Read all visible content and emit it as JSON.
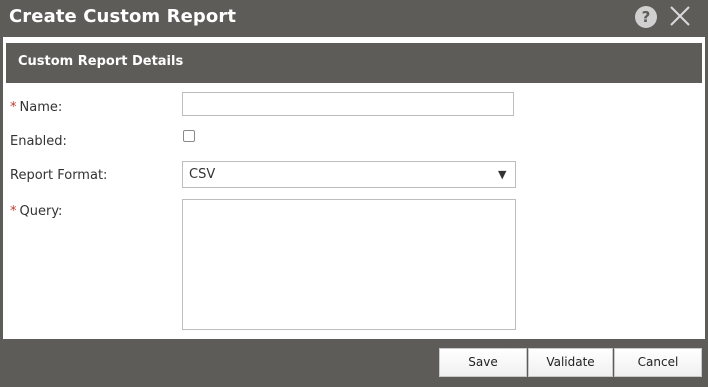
{
  "dialog": {
    "title": "Create Custom Report",
    "help_icon": "help-icon",
    "help_glyph": "?",
    "close_icon": "close-icon"
  },
  "section": {
    "title": "Custom Report Details"
  },
  "form": {
    "required_marker": "*",
    "name": {
      "label": "Name:",
      "required": true,
      "value": ""
    },
    "enabled": {
      "label": "Enabled:",
      "checked": false
    },
    "report_format": {
      "label": "Report Format:",
      "selected": "CSV",
      "arrow": "▼"
    },
    "query": {
      "label": "Query:",
      "required": true,
      "value": ""
    }
  },
  "buttons": {
    "save": "Save",
    "validate": "Validate",
    "cancel": "Cancel"
  },
  "colors": {
    "chrome": "#5e5c59",
    "required": "#c0392b",
    "input_border": "#bdbdbd"
  }
}
